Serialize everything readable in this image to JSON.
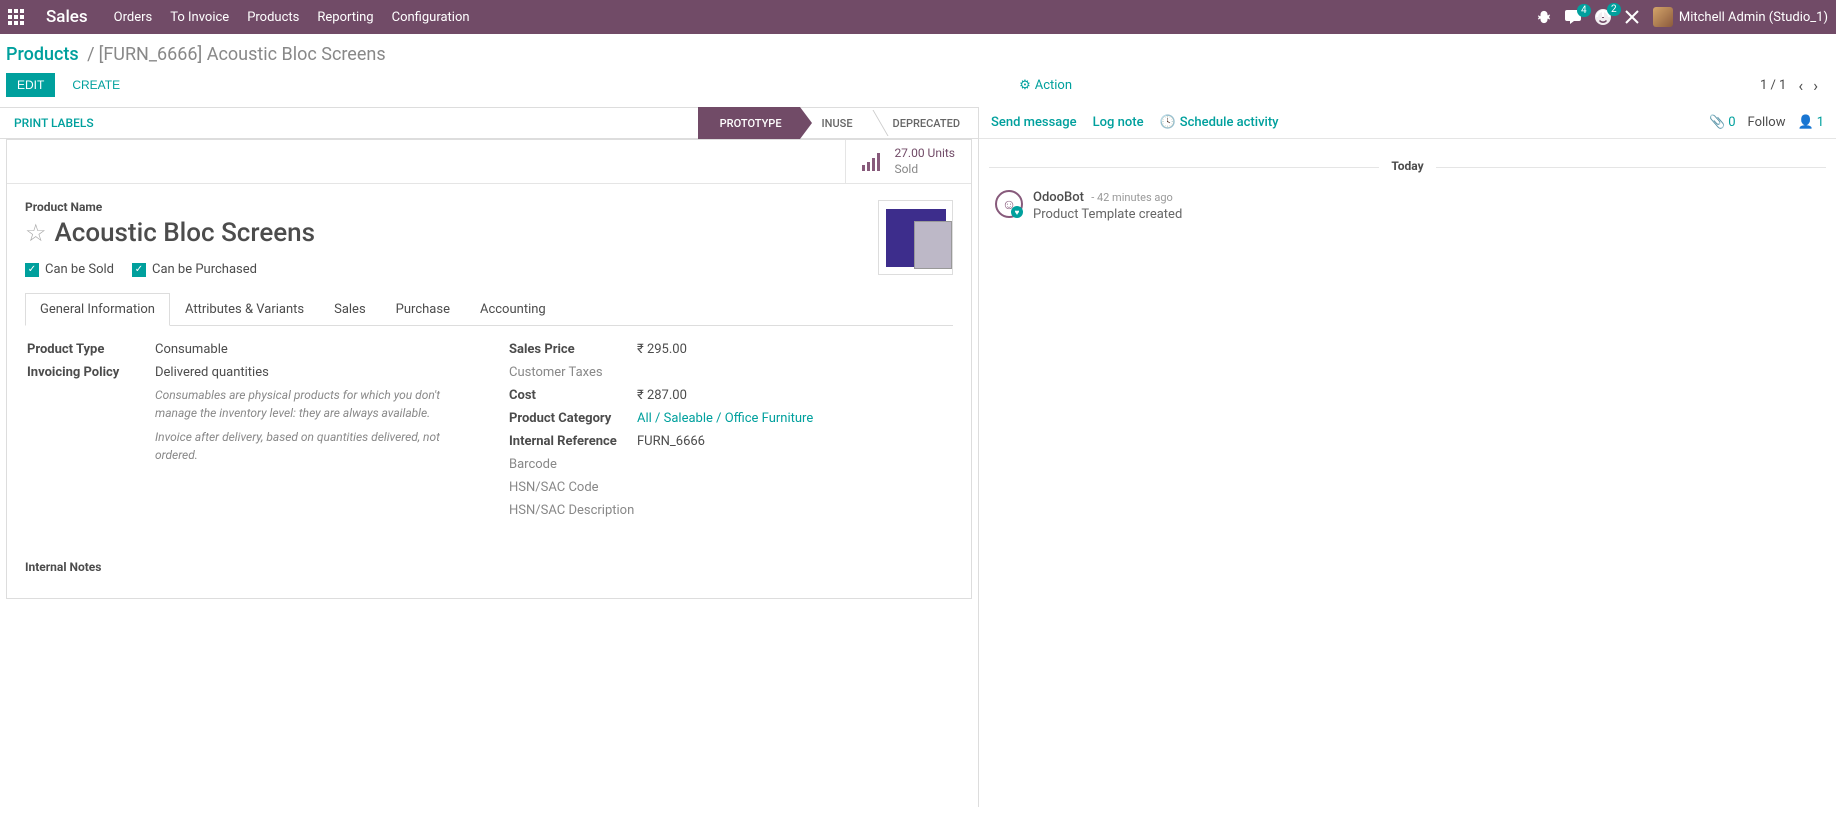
{
  "navbar": {
    "brand": "Sales",
    "menu": [
      "Orders",
      "To Invoice",
      "Products",
      "Reporting",
      "Configuration"
    ],
    "messages_badge": "4",
    "activities_badge": "2",
    "user_name": "Mitchell Admin (Studio_1)"
  },
  "breadcrumb": {
    "root": "Products",
    "separator": "/",
    "current": "[FURN_6666] Acoustic Bloc Screens"
  },
  "controls": {
    "edit": "EDIT",
    "create": "CREATE",
    "action": "Action",
    "pager": "1 / 1"
  },
  "statusbar": {
    "print_labels": "PRINT LABELS",
    "steps": [
      "PROTOTYPE",
      "INUSE",
      "DEPRECATED"
    ]
  },
  "stat_button": {
    "value": "27.00 Units",
    "label": "Sold"
  },
  "product": {
    "name_label": "Product Name",
    "name": "Acoustic Bloc Screens",
    "can_be_sold": "Can be Sold",
    "can_be_purchased": "Can be Purchased"
  },
  "tabs": [
    "General Information",
    "Attributes & Variants",
    "Sales",
    "Purchase",
    "Accounting"
  ],
  "left_fields": {
    "product_type_label": "Product Type",
    "product_type_value": "Consumable",
    "invoicing_policy_label": "Invoicing Policy",
    "invoicing_policy_value": "Delivered quantities",
    "help1": "Consumables are physical products for which you don't manage the inventory level: they are always available.",
    "help2": "Invoice after delivery, based on quantities delivered, not ordered."
  },
  "right_fields": {
    "sales_price_label": "Sales Price",
    "sales_price_value": "₹ 295.00",
    "customer_taxes_label": "Customer Taxes",
    "cost_label": "Cost",
    "cost_value": "₹ 287.00",
    "product_category_label": "Product Category",
    "product_category_value": "All / Saleable / Office Furniture",
    "internal_reference_label": "Internal Reference",
    "internal_reference_value": "FURN_6666",
    "barcode_label": "Barcode",
    "hsn_code_label": "HSN/SAC Code",
    "hsn_desc_label": "HSN/SAC Description"
  },
  "internal_notes_label": "Internal Notes",
  "chatter": {
    "send_message": "Send message",
    "log_note": "Log note",
    "schedule_activity": "Schedule activity",
    "attach_count": "0",
    "follow": "Follow",
    "follower_count": "1",
    "date_label": "Today",
    "message": {
      "author": "OdooBot",
      "time": "- 42 minutes ago",
      "body": "Product Template created"
    }
  }
}
